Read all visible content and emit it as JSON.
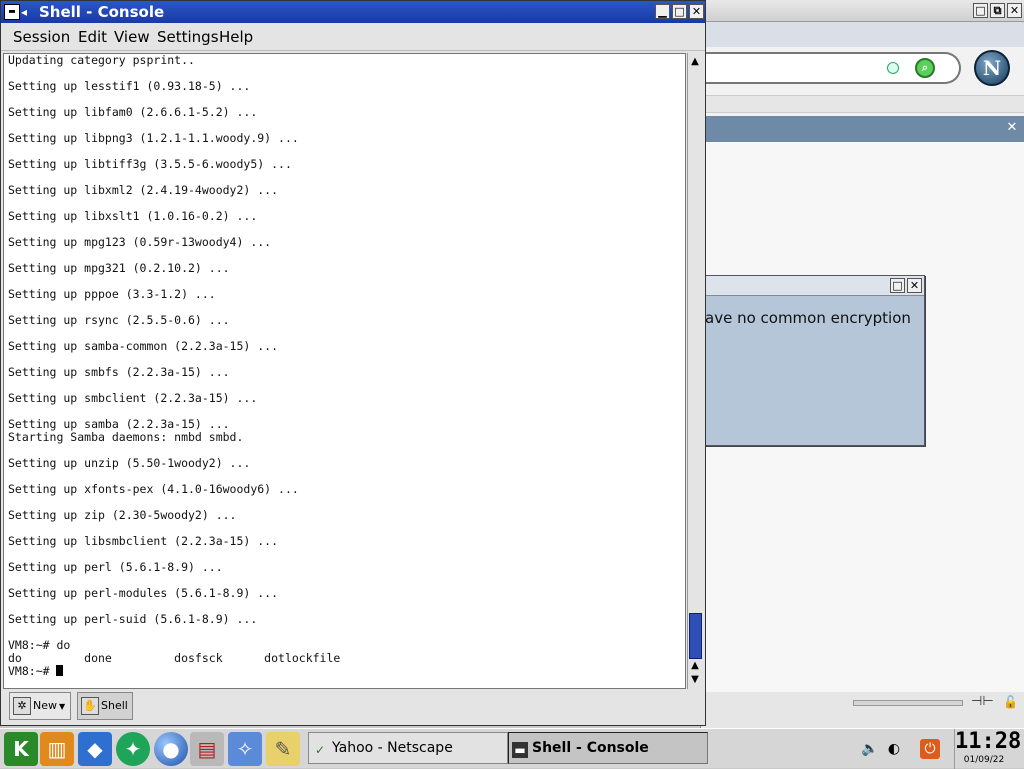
{
  "netscape": {
    "window_buttons": [
      "□",
      "⧉",
      "✕"
    ],
    "search_icon": "magnifier-icon",
    "logo_letter": "N",
    "sidebar_close": "✕",
    "dialog_message": "ave no common encryption",
    "dialog_buttons": [
      "□",
      "✕"
    ]
  },
  "konsole": {
    "title": "Shell - Console",
    "window_buttons": [
      "▁",
      "□",
      "✕"
    ],
    "menu": [
      "Session",
      "Edit",
      "View",
      "Settings",
      "Help"
    ],
    "terminal_lines": [
      "Updating category psprint..",
      "",
      "Setting up lesstif1 (0.93.18-5) ...",
      "",
      "Setting up libfam0 (2.6.6.1-5.2) ...",
      "",
      "Setting up libpng3 (1.2.1-1.1.woody.9) ...",
      "",
      "Setting up libtiff3g (3.5.5-6.woody5) ...",
      "",
      "Setting up libxml2 (2.4.19-4woody2) ...",
      "",
      "Setting up libxslt1 (1.0.16-0.2) ...",
      "",
      "Setting up mpg123 (0.59r-13woody4) ...",
      "",
      "Setting up mpg321 (0.2.10.2) ...",
      "",
      "Setting up pppoe (3.3-1.2) ...",
      "",
      "Setting up rsync (2.5.5-0.6) ...",
      "",
      "Setting up samba-common (2.2.3a-15) ...",
      "",
      "Setting up smbfs (2.2.3a-15) ...",
      "",
      "Setting up smbclient (2.2.3a-15) ...",
      "",
      "Setting up samba (2.2.3a-15) ...",
      "Starting Samba daemons: nmbd smbd.",
      "",
      "Setting up unzip (5.50-1woody2) ...",
      "",
      "Setting up xfonts-pex (4.1.0-16woody6) ...",
      "",
      "Setting up zip (2.30-5woody2) ...",
      "",
      "Setting up libsmbclient (2.2.3a-15) ...",
      "",
      "Setting up perl (5.6.1-8.9) ...",
      "",
      "Setting up perl-modules (5.6.1-8.9) ...",
      "",
      "Setting up perl-suid (5.6.1-8.9) ...",
      "",
      "VM8:~# do",
      "do         done         dosfsck      dotlockfile"
    ],
    "prompt": "VM8:~# ",
    "scroll_up": "▲",
    "scroll_down": "▼",
    "tabs": [
      {
        "label": "New",
        "icon": "new-session-icon"
      },
      {
        "label": "Shell",
        "icon": "shell-icon"
      }
    ]
  },
  "taskbar": {
    "launchers": [
      {
        "name": "kde-menu-icon",
        "glyph": "K"
      },
      {
        "name": "lifejacket-icon",
        "glyph": "▥"
      },
      {
        "name": "cube-icon",
        "glyph": "◆"
      },
      {
        "name": "running-man-icon",
        "glyph": "✦"
      },
      {
        "name": "globe-icon",
        "glyph": "●"
      },
      {
        "name": "printer-icon",
        "glyph": "▤"
      },
      {
        "name": "runner-globe-icon",
        "glyph": "✧"
      },
      {
        "name": "pencil-icon",
        "glyph": "✎"
      }
    ],
    "tasks": [
      {
        "label": "Yahoo - Netscape",
        "icon": "netscape-icon",
        "active": false
      },
      {
        "label": "Shell - Console",
        "icon": "konsole-icon",
        "active": true
      }
    ],
    "clock_time": "11:28",
    "clock_date": "01/09/22"
  }
}
